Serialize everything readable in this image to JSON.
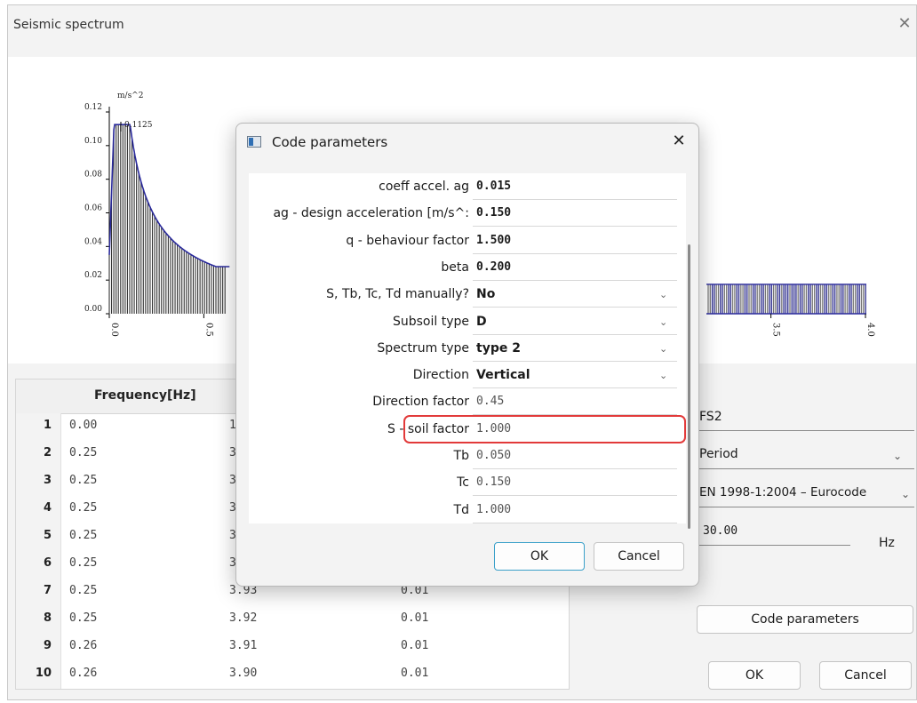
{
  "window": {
    "title": "Seismic spectrum",
    "close_glyph": "✕"
  },
  "chart": {
    "unit_label": "m/s^2",
    "peak_label": "0.1125",
    "y_ticks": [
      "0.12",
      "0.10",
      "0.08",
      "0.06",
      "0.04",
      "0.02",
      "0.00"
    ],
    "x_ticks_left": [
      "0.0",
      "0.5"
    ],
    "x_ticks_right": [
      "3.5",
      "4.0"
    ],
    "line_color": "#2a2a9c"
  },
  "chart_data": {
    "type": "bar",
    "xlabel": "",
    "ylabel": "m/s^2",
    "ylim": [
      0,
      0.12
    ],
    "xlim": [
      0,
      4.0
    ],
    "x_ticks": [
      "0.0",
      "0.5",
      "3.5",
      "4.0"
    ],
    "y_ticks": [
      "0.00",
      "0.02",
      "0.04",
      "0.06",
      "0.08",
      "0.10",
      "0.12"
    ],
    "annotations": [
      "0.1125"
    ],
    "x": [
      0.0,
      0.05,
      0.1,
      0.15,
      0.2,
      0.25,
      0.3,
      0.35,
      0.4,
      0.45,
      0.5,
      0.55,
      0.6,
      0.65,
      3.2,
      3.5,
      3.8,
      4.0
    ],
    "values": [
      0.03,
      0.1125,
      0.1125,
      0.1125,
      0.095,
      0.075,
      0.061,
      0.052,
      0.045,
      0.04,
      0.036,
      0.033,
      0.031,
      0.029,
      0.016,
      0.016,
      0.016,
      0.016
    ]
  },
  "table": {
    "header_frequency": "Frequency[Hz]",
    "rows": [
      {
        "n": "1",
        "freq": "0.00",
        "c2": "1",
        "c3": ""
      },
      {
        "n": "2",
        "freq": "0.25",
        "c2": "3",
        "c3": ""
      },
      {
        "n": "3",
        "freq": "0.25",
        "c2": "3",
        "c3": ""
      },
      {
        "n": "4",
        "freq": "0.25",
        "c2": "3",
        "c3": ""
      },
      {
        "n": "5",
        "freq": "0.25",
        "c2": "3",
        "c3": ""
      },
      {
        "n": "6",
        "freq": "0.25",
        "c2": "3",
        "c3": ""
      },
      {
        "n": "7",
        "freq": "0.25",
        "c2": "3.93",
        "c3": "0.01"
      },
      {
        "n": "8",
        "freq": "0.25",
        "c2": "3.92",
        "c3": "0.01"
      },
      {
        "n": "9",
        "freq": "0.26",
        "c2": "3.91",
        "c3": "0.01"
      },
      {
        "n": "10",
        "freq": "0.26",
        "c2": "3.90",
        "c3": "0.01"
      }
    ]
  },
  "right_panel": {
    "name_value": "FS2",
    "type_value": "Period",
    "code_value": "EN 1998-1:2004 – Eurocode",
    "max_value": "30.00",
    "max_unit": "Hz",
    "code_params_button": "Code parameters",
    "ok_button": "OK",
    "cancel_button": "Cancel"
  },
  "dialog": {
    "title": "Code parameters",
    "close_glyph": "✕",
    "params": [
      {
        "label": "coeff accel. ag",
        "value": "0.015",
        "dropdown": false,
        "readonly": false
      },
      {
        "label": "ag - design acceleration [m/s^:",
        "value": "0.150",
        "dropdown": false,
        "readonly": false
      },
      {
        "label": "q - behaviour factor",
        "value": "1.500",
        "dropdown": false,
        "readonly": false
      },
      {
        "label": "beta",
        "value": "0.200",
        "dropdown": false,
        "readonly": false
      },
      {
        "label": "S, Tb, Tc, Td manually?",
        "value": "No",
        "dropdown": true,
        "readonly": false
      },
      {
        "label": "Subsoil type",
        "value": "D",
        "dropdown": true,
        "readonly": false
      },
      {
        "label": "Spectrum type",
        "value": "type 2",
        "dropdown": true,
        "readonly": false
      },
      {
        "label": "Direction",
        "value": "Vertical",
        "dropdown": true,
        "readonly": false
      },
      {
        "label": "Direction factor",
        "value": "0.45",
        "dropdown": false,
        "readonly": true
      },
      {
        "label": "S - soil factor",
        "value": "1.000",
        "dropdown": false,
        "readonly": true
      },
      {
        "label": "Tb",
        "value": "0.050",
        "dropdown": false,
        "readonly": true
      },
      {
        "label": "Tc",
        "value": "0.150",
        "dropdown": false,
        "readonly": true
      },
      {
        "label": "Td",
        "value": "1.000",
        "dropdown": false,
        "readonly": true
      }
    ],
    "ok_button": "OK",
    "cancel_button": "Cancel",
    "highlight_color": "#e23a3a"
  },
  "icons": {
    "dropdown": "chevron-down-icon",
    "close": "close-icon",
    "dialog_app": "app-window-icon"
  }
}
